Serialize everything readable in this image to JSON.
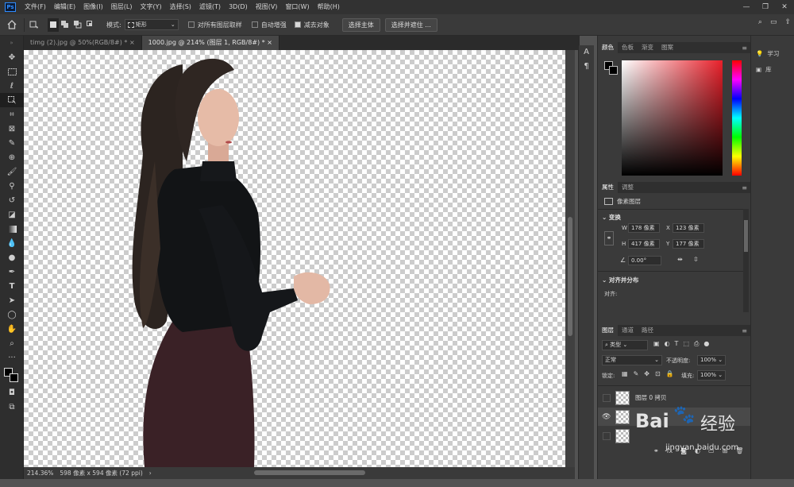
{
  "menubar": {
    "logo": "Ps",
    "items": [
      "文件(F)",
      "编辑(E)",
      "图像(I)",
      "图层(L)",
      "文字(Y)",
      "选择(S)",
      "滤镜(T)",
      "3D(D)",
      "视图(V)",
      "窗口(W)",
      "帮助(H)"
    ],
    "window_controls": [
      "—",
      "❐",
      "✕"
    ]
  },
  "options": {
    "style_label": "模式:",
    "style_value": "矩形",
    "sample_all": "对所有图层取样",
    "auto_enhance": "自动增强",
    "subtract": "减去对象",
    "select_subject": "选择主体",
    "select_mask": "选择并遮住 ..."
  },
  "doc_tabs": [
    {
      "label": "timg (2).jpg @ 50%(RGB/8#) *",
      "close": "×"
    },
    {
      "label": "1000.jpg @ 214% (图层 1, RGB/8#) *",
      "close": "×"
    }
  ],
  "status": {
    "zoom": "214.36%",
    "doc_info": "598 像素 x 594 像素 (72 ppi)",
    "arrow": "›"
  },
  "color_panel": {
    "tabs": [
      "颜色",
      "色板",
      "渐变",
      "图案"
    ],
    "accent": "#e8202a"
  },
  "properties_panel": {
    "tabs": [
      "属性",
      "调整"
    ],
    "kind": "像素图层",
    "transform_title": "变换",
    "w_label": "W",
    "w_value": "178 像素",
    "h_label": "H",
    "h_value": "417 像素",
    "x_label": "X",
    "x_value": "123 像素",
    "y_label": "Y",
    "y_value": "177 像素",
    "angle_value": "0.00°",
    "align_title": "对齐并分布",
    "align_label": "对齐:"
  },
  "layers_panel": {
    "tabs": [
      "图层",
      "通道",
      "路径"
    ],
    "filter": "类型",
    "blend_mode": "正常",
    "opacity_label": "不透明度:",
    "opacity_value": "100%",
    "lock_label": "锁定:",
    "fill_label": "填充:",
    "fill_value": "100%",
    "layers": [
      {
        "name": "图层 0 拷贝",
        "visible": false
      },
      {
        "name": "",
        "visible": true
      },
      {
        "name": "",
        "visible": false
      }
    ]
  },
  "right_column": {
    "items": [
      {
        "label": "学习",
        "icon": "lightbulb-icon"
      },
      {
        "label": "库",
        "icon": "library-icon"
      }
    ]
  },
  "char_panel": {
    "label_a": "A",
    "label_p": "¶"
  },
  "watermark": {
    "brand": "Bai",
    "brand_cn": "经验",
    "url": "jingyan.baidu.com"
  }
}
